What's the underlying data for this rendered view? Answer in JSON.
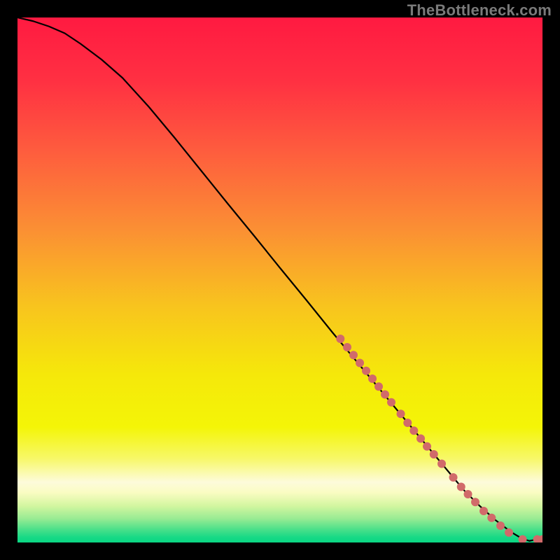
{
  "watermark": "TheBottleneck.com",
  "chart_data": {
    "type": "line",
    "title": "",
    "xlabel": "",
    "ylabel": "",
    "xlim": [
      0,
      100
    ],
    "ylim": [
      0,
      100
    ],
    "background_gradient": {
      "stops": [
        {
          "offset": 0.0,
          "color": "#ff1a41"
        },
        {
          "offset": 0.12,
          "color": "#ff3042"
        },
        {
          "offset": 0.25,
          "color": "#fe5b3e"
        },
        {
          "offset": 0.4,
          "color": "#fb8e34"
        },
        {
          "offset": 0.55,
          "color": "#f8c41e"
        },
        {
          "offset": 0.68,
          "color": "#f5e80a"
        },
        {
          "offset": 0.78,
          "color": "#f4f507"
        },
        {
          "offset": 0.84,
          "color": "#f7f868"
        },
        {
          "offset": 0.885,
          "color": "#fdfbdb"
        },
        {
          "offset": 0.905,
          "color": "#fafcc2"
        },
        {
          "offset": 0.93,
          "color": "#d3f6a0"
        },
        {
          "offset": 0.955,
          "color": "#97eb93"
        },
        {
          "offset": 0.975,
          "color": "#4be08a"
        },
        {
          "offset": 0.99,
          "color": "#18d986"
        },
        {
          "offset": 1.0,
          "color": "#0ad783"
        }
      ]
    },
    "series": [
      {
        "name": "curve",
        "x": [
          0,
          3,
          6,
          9,
          12,
          16,
          20,
          25,
          30,
          35,
          40,
          45,
          50,
          55,
          60,
          65,
          70,
          75,
          80,
          85,
          88,
          91,
          94,
          96,
          97.5,
          99,
          100
        ],
        "y": [
          100,
          99.3,
          98.3,
          97.0,
          95.0,
          92.0,
          88.5,
          83.0,
          77.0,
          70.8,
          64.6,
          58.5,
          52.3,
          46.2,
          40.0,
          34.0,
          28.0,
          22.0,
          16.0,
          10.0,
          7.0,
          4.3,
          2.0,
          0.8,
          0.3,
          0.6,
          0.6
        ]
      }
    ],
    "markers": {
      "name": "highlighted-points",
      "color": "#d16a6a",
      "radius": 6,
      "points": [
        {
          "x": 61.5,
          "y": 38.8
        },
        {
          "x": 62.8,
          "y": 37.2
        },
        {
          "x": 64.0,
          "y": 35.7
        },
        {
          "x": 65.2,
          "y": 34.2
        },
        {
          "x": 66.4,
          "y": 32.7
        },
        {
          "x": 67.6,
          "y": 31.2
        },
        {
          "x": 68.8,
          "y": 29.7
        },
        {
          "x": 70.0,
          "y": 28.2
        },
        {
          "x": 71.2,
          "y": 26.7
        },
        {
          "x": 73.0,
          "y": 24.5
        },
        {
          "x": 74.3,
          "y": 22.8
        },
        {
          "x": 75.5,
          "y": 21.3
        },
        {
          "x": 76.8,
          "y": 19.8
        },
        {
          "x": 78.0,
          "y": 18.3
        },
        {
          "x": 79.3,
          "y": 16.8
        },
        {
          "x": 80.8,
          "y": 15.0
        },
        {
          "x": 83.0,
          "y": 12.4
        },
        {
          "x": 84.5,
          "y": 10.6
        },
        {
          "x": 85.8,
          "y": 9.2
        },
        {
          "x": 87.2,
          "y": 7.7
        },
        {
          "x": 88.8,
          "y": 6.0
        },
        {
          "x": 90.3,
          "y": 4.7
        },
        {
          "x": 92.0,
          "y": 3.2
        },
        {
          "x": 93.6,
          "y": 1.9
        },
        {
          "x": 96.2,
          "y": 0.6
        },
        {
          "x": 99.0,
          "y": 0.6
        },
        {
          "x": 100.0,
          "y": 0.6
        }
      ]
    }
  }
}
